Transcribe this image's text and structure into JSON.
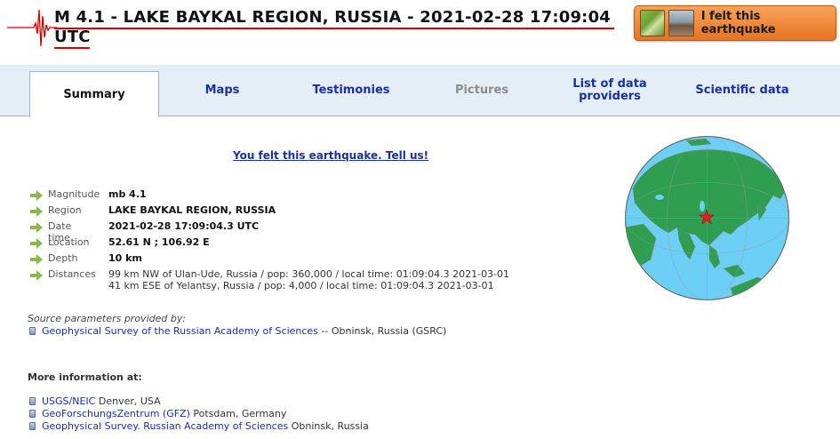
{
  "header": {
    "title_line1": "M 4.1 - LAKE BAYKAL REGION, RUSSIA - 2021-02-28 17:09:04",
    "title_line2": "UTC",
    "felt_button_label": "I felt this earthquake"
  },
  "tabs": [
    {
      "label": "Summary",
      "state": "active"
    },
    {
      "label": "Maps",
      "state": "normal"
    },
    {
      "label": "Testimonies",
      "state": "normal"
    },
    {
      "label": "Pictures",
      "state": "disabled"
    },
    {
      "label": "List of data providers",
      "state": "normal"
    },
    {
      "label": "Scientific data",
      "state": "normal"
    }
  ],
  "tell_us_link": "You felt this earthquake. Tell us!",
  "parameters": {
    "magnitude": {
      "label": "Magnitude",
      "value": "mb 4.1"
    },
    "region": {
      "label": "Region",
      "value": "LAKE BAYKAL REGION, RUSSIA"
    },
    "datetime": {
      "label": "Date time",
      "value": "2021-02-28 17:09:04.3 UTC"
    },
    "location": {
      "label": "Location",
      "value": "52.61 N ; 106.92 E"
    },
    "depth": {
      "label": "Depth",
      "value": "10 km"
    },
    "distances": {
      "label": "Distances",
      "line1": "99 km NW of Ulan-Ude, Russia / pop: 360,000 / local time: 01:09:04.3 2021-03-01",
      "line2": "41 km ESE of Yelantsy, Russia / pop: 4,000 / local time: 01:09:04.3 2021-03-01"
    }
  },
  "source": {
    "caption": "Source parameters provided by:",
    "link": "Geophysical Survey of the Russian Academy of Sciences",
    "suffix": " -- Obninsk, Russia (GSRC)"
  },
  "more_info": {
    "heading": "More information at:",
    "items": [
      {
        "link": "USGS/NEIC",
        "suffix": " Denver, USA"
      },
      {
        "link": "GeoForschungsZentrum (GFZ)",
        "suffix": " Potsdam, Germany"
      },
      {
        "link": "Geophysical Survey. Russian Academy of Sciences",
        "suffix": " Obninsk, Russia"
      }
    ]
  },
  "colors": {
    "accent_link": "#1a2fa0",
    "title_underline": "#d00000",
    "tab_bar": "#e4eef7",
    "button_orange": "#e8731f",
    "ocean": "#6ecff6",
    "land": "#2f9e50",
    "epicenter": "#e02020"
  },
  "icons": {
    "param_arrow": "arrow-right-icon",
    "seismogram": "seismogram-icon",
    "globe": "globe-map",
    "epicenter": "star-icon",
    "link_bullet": "document-bullet-icon"
  }
}
